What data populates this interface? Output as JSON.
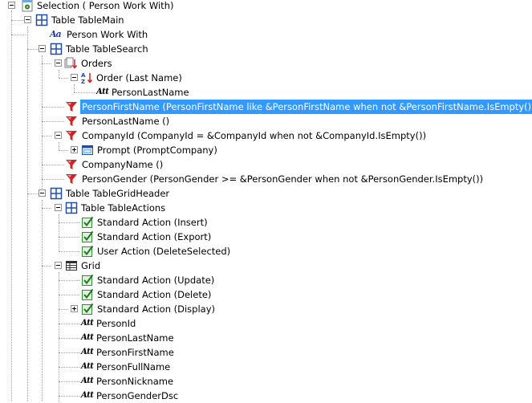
{
  "tree": {
    "selection": "Selection ( Person Work With)",
    "table_main": "Table TableMain",
    "person_work_with": "Person Work With",
    "table_search": "Table TableSearch",
    "orders": "Orders",
    "order_last_name": "Order (Last Name)",
    "person_last_name_att": "PersonLastName",
    "filter_person_first_name": "PersonFirstName (PersonFirstName like &PersonFirstName when not &PersonFirstName.IsEmpty())",
    "filter_person_last_name": "PersonLastName ()",
    "filter_company_id": "CompanyId (CompanyId = &CompanyId when not &CompanyId.IsEmpty())",
    "prompt_company": "Prompt (PromptCompany)",
    "filter_company_name": "CompanyName ()",
    "filter_person_gender": "PersonGender (PersonGender >= &PersonGender when not &PersonGender.IsEmpty())",
    "table_grid_header": "Table TableGridHeader",
    "table_actions": "Table TableActions",
    "action_insert": "Standard Action (Insert)",
    "action_export": "Standard Action (Export)",
    "action_delete_selected": "User Action (DeleteSelected)",
    "grid": "Grid",
    "action_update": "Standard Action (Update)",
    "action_delete": "Standard Action (Delete)",
    "action_display": "Standard Action (Display)",
    "att_person_id": "PersonId",
    "att_person_last_name": "PersonLastName",
    "att_person_first_name": "PersonFirstName",
    "att_person_full_name": "PersonFullName",
    "att_person_nickname": "PersonNickname",
    "att_person_gender_dsc": "PersonGenderDsc"
  },
  "icons": {
    "att_text": "Att",
    "aa_text": "Aa"
  },
  "colors": {
    "selection_bg": "#3399ff",
    "filter_red": "#d42020",
    "table_blue": "#1f4fa8",
    "action_green": "#2f8f2f"
  }
}
